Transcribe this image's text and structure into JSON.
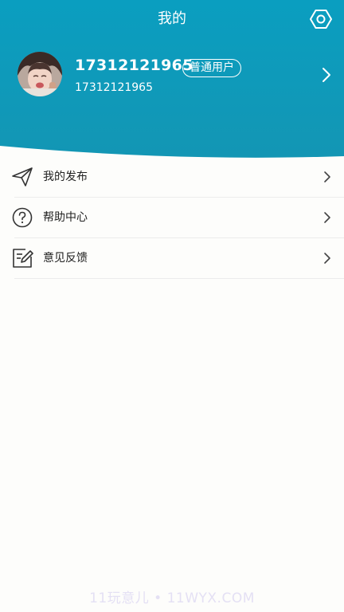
{
  "colors": {
    "header_top": "#0a9ec0",
    "header_bottom": "#1195b5",
    "background": "#fdfdfb"
  },
  "header": {
    "title": "我的",
    "settings_icon": "hexagon-gear-icon"
  },
  "profile": {
    "username": "17312121965",
    "badge": "普通用户",
    "phone": "17312121965"
  },
  "menu": [
    {
      "label": "我的发布",
      "icon": "paper-plane-icon"
    },
    {
      "label": "帮助中心",
      "icon": "question-circle-icon"
    },
    {
      "label": "意见反馈",
      "icon": "edit-note-icon"
    }
  ],
  "watermark": "11玩意儿 • 11WYX.COM"
}
